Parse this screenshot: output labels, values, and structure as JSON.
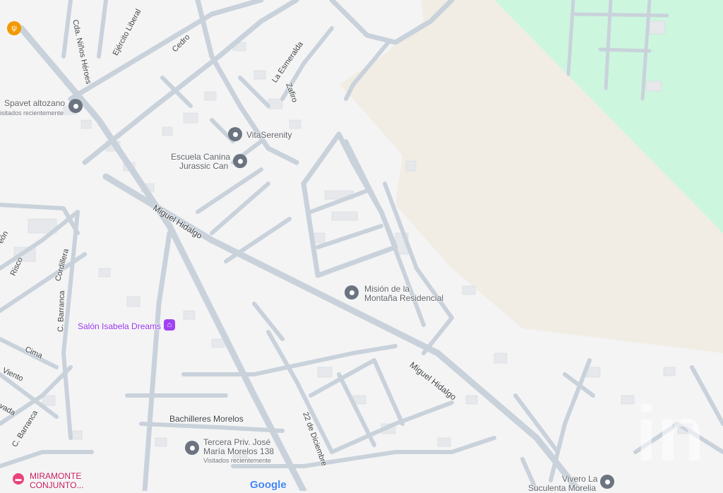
{
  "colors": {
    "background": "#f4f4f5",
    "road": "#c9d2db",
    "sand_area": "#f1ede4",
    "green_area": "#cdf6df",
    "pin": "#6b7480",
    "purple_poi": "#a142f4",
    "pink_poi": "#e8437a",
    "orange_poi": "#f29900"
  },
  "places": [
    {
      "name": "Spavet altozano",
      "note": "isitados recientemente",
      "icon": "pin-icon"
    },
    {
      "name": "VitaSerenity",
      "icon": "pin-icon"
    },
    {
      "name": "Escuela Canina",
      "name2": "Jurassic Can",
      "icon": "pin-icon"
    },
    {
      "name": "Misión de la",
      "name2": "Montaña Residencial",
      "icon": "pin-icon"
    },
    {
      "name": "Salón Isabela Dreams",
      "icon": "event-venue-icon"
    },
    {
      "name": "Tercera Priv. José",
      "name2": "María Morelos 138",
      "note": "Visitados recientemente",
      "icon": "pin-icon"
    },
    {
      "name": "MIRAMONTE",
      "name2": "CONJUNTO...",
      "icon": "hotel-icon"
    },
    {
      "name": "Vivero La",
      "name2": "Suculenta Morelia",
      "icon": "pin-icon"
    },
    {
      "name": "",
      "icon": "restaurant-icon"
    }
  ],
  "streets": {
    "cda_ninos_heroes": "Cda. Niños Héroes",
    "ejercito_liberal": "Ejército Liberal",
    "cedro": "Cedro",
    "la_esmeralda": "La Esmeralda",
    "zafiro": "Zafiro",
    "miguel_hidalgo_1": "Miguel Hidalgo",
    "miguel_hidalgo_2": "Miguel Hidalgo",
    "risco": "Risco",
    "cordillera": "Cordillera",
    "c_barranca_1": "C. Barranca",
    "c_barranca_2": "C. Barranca",
    "cima": "Cima",
    "viento": "Viento",
    "vada": "vada",
    "eron": "eón",
    "bachilleres_morelos": "Bachilleres Morelos",
    "dic_22": "22 de Diciembre"
  },
  "branding": {
    "google": "Google",
    "watermark": "in"
  }
}
